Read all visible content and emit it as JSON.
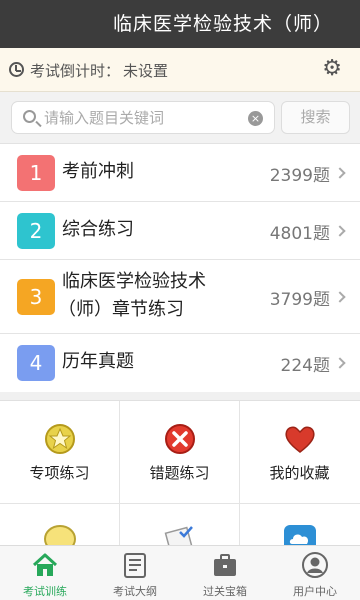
{
  "header": {
    "title": "临床医学检验技术（师）"
  },
  "countdown": {
    "label": "考试倒计时：",
    "value": "未设置",
    "settings_icon": "gear-icon"
  },
  "search": {
    "placeholder": "请输入题目关键词",
    "button_label": "搜索"
  },
  "modules": [
    {
      "index": "1",
      "name": "考前冲刺",
      "count": "2399题",
      "color": "#f37273"
    },
    {
      "index": "2",
      "name": "综合练习",
      "count": "4801题",
      "color": "#2ec4cf"
    },
    {
      "index": "3",
      "name_line1": "临床医学检验技术",
      "name_line2": "（师）章节练习",
      "count": "3799题",
      "color": "#f5a623"
    },
    {
      "index": "4",
      "name": "历年真题",
      "count": "224题",
      "color": "#7a9df0"
    }
  ],
  "features": [
    {
      "label": "专项练习",
      "icon": "star-icon"
    },
    {
      "label": "错题练习",
      "icon": "wrong-icon"
    },
    {
      "label": "我的收藏",
      "icon": "heart-icon"
    },
    {
      "label": "",
      "icon": "note-icon"
    },
    {
      "label": "",
      "icon": "checklist-icon"
    },
    {
      "label": "",
      "icon": "cloud-icon"
    }
  ],
  "tabbar": {
    "active_color": "#27a85a",
    "items": [
      {
        "label": "考试训练",
        "icon": "home-icon",
        "active": true
      },
      {
        "label": "考试大纲",
        "icon": "outline-icon",
        "active": false
      },
      {
        "label": "过关宝箱",
        "icon": "briefcase-icon",
        "active": false
      },
      {
        "label": "用户中心",
        "icon": "user-icon",
        "active": false
      }
    ]
  }
}
